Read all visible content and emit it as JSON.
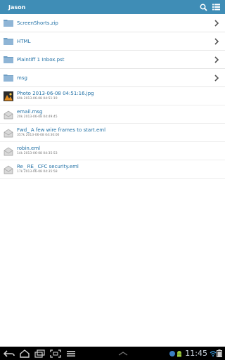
{
  "header": {
    "title": "Jason",
    "colors": {
      "bar": "#3f8db6",
      "link": "#1f6fa5"
    }
  },
  "folders": [
    {
      "name": "ScreenShorts.zip"
    },
    {
      "name": "HTML"
    },
    {
      "name": "Plaintiff 1 Inbox.pst"
    },
    {
      "name": "msg"
    }
  ],
  "files": [
    {
      "name": "Photo 2013-06-08 04:51:16.jpg",
      "meta": "69k 2013-06-08 04:51:19",
      "icon": "photo-file-icon"
    },
    {
      "name": "email.msg",
      "meta": "20k 2013-06-08 04:49:45",
      "icon": "email-file-icon"
    },
    {
      "name": "Fwd_ A few wire frames to start.eml",
      "meta": "357k 2013-06-08 04:30:00",
      "icon": "email-file-icon"
    },
    {
      "name": "robin.eml",
      "meta": "14k 2013-06-08 04:35:53",
      "icon": "email-file-icon"
    },
    {
      "name": "Re_ RE_ CFC security.eml",
      "meta": "17k 2013-06-08 04:35:58",
      "icon": "email-file-icon"
    }
  ],
  "system_bar": {
    "time": "11:45"
  }
}
